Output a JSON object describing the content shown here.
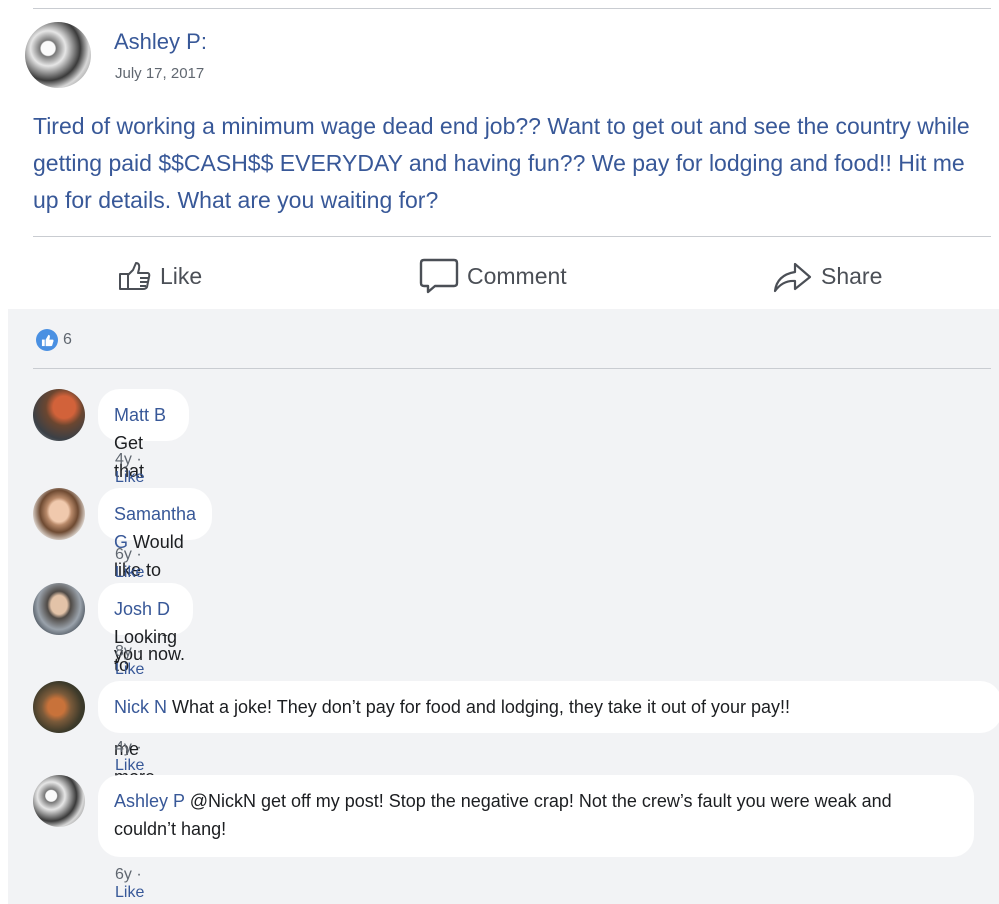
{
  "post": {
    "author": "Ashley P:",
    "date": "July 17, 2017",
    "text": "Tired of working a minimum wage dead end job?? Want to get out and see the country while getting paid $$CASH$$ EVERYDAY and having fun?? We pay for lodging and food!! Hit me up for details. What are you waiting for?"
  },
  "actions": {
    "like": "Like",
    "comment": "Comment",
    "share": "Share"
  },
  "reactions": {
    "count": "6",
    "icon": "thumbs-up-icon"
  },
  "comments": [
    {
      "name": "Matt B",
      "text": " Get that money!",
      "age": "4y",
      "sep": " · ",
      "like": "Like"
    },
    {
      "name": "Samantha G",
      "text": " Would like to apply. DM’ing you now.",
      "age": "6y",
      "sep": " · ",
      "like": "Like"
    },
    {
      "name": "Josh D",
      "text": " Looking to apply! Send me more info.",
      "age": "8y",
      "sep": " · ",
      "like": "Like"
    },
    {
      "name": "Nick N",
      "text": " What a joke! They don’t pay for food and lodging, they take it out of your pay!!",
      "age": "4y",
      "sep": " · ",
      "like": "Like"
    },
    {
      "name": "Ashley P",
      "text": " @NickN get off my post! Stop the negative crap! Not the crew’s fault you were weak and couldn’t hang!",
      "age": "6y",
      "sep": " · ",
      "like": "Like"
    }
  ],
  "colors": {
    "link": "#385898",
    "panel": "#f2f3f5",
    "like_badge": "#4a90e2"
  }
}
